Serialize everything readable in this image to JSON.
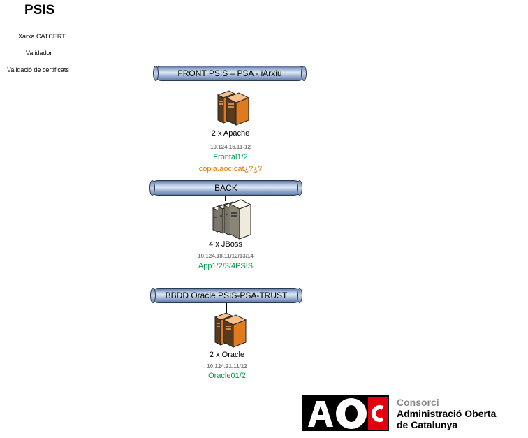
{
  "title": "PSIS",
  "side_labels": [
    "Xarxa CATCERT",
    "Validador",
    "Validació de certificats"
  ],
  "tiers": [
    {
      "bus_label": "FRONT PSIS – PSA - iArxiu",
      "server_icon": "server-pair-icon",
      "count_label": "2 x Apache",
      "ip": "10.124.16.11-12",
      "hostnames": "Frontal1/2",
      "alias": "copia.aoc.cat¿?¿?"
    },
    {
      "bus_label": "BACK",
      "server_icon": "server-quad-icon",
      "count_label": "4 x JBoss",
      "ip": "10.124.18.11/12/13/14",
      "hostnames": "App1/2/3/4PSIS"
    },
    {
      "bus_label": "BBDD Oracle PSIS-PSA-TRUST",
      "server_icon": "server-pair-icon",
      "count_label": "2 x Oracle",
      "ip": "10.124.21.11/12",
      "hostnames": "Oracle01/2"
    }
  ],
  "logo": {
    "mark": "AOC",
    "line1": "Consorci",
    "line2": "Administració Oberta",
    "line3": "de Catalunya"
  },
  "colors": {
    "hostname": "#00a050",
    "alias": "#e07a00",
    "ip": "#7f7f7f",
    "pipe": "#a9bddb",
    "server_orange": "#e07a1e",
    "logo_red": "#e3000f"
  }
}
